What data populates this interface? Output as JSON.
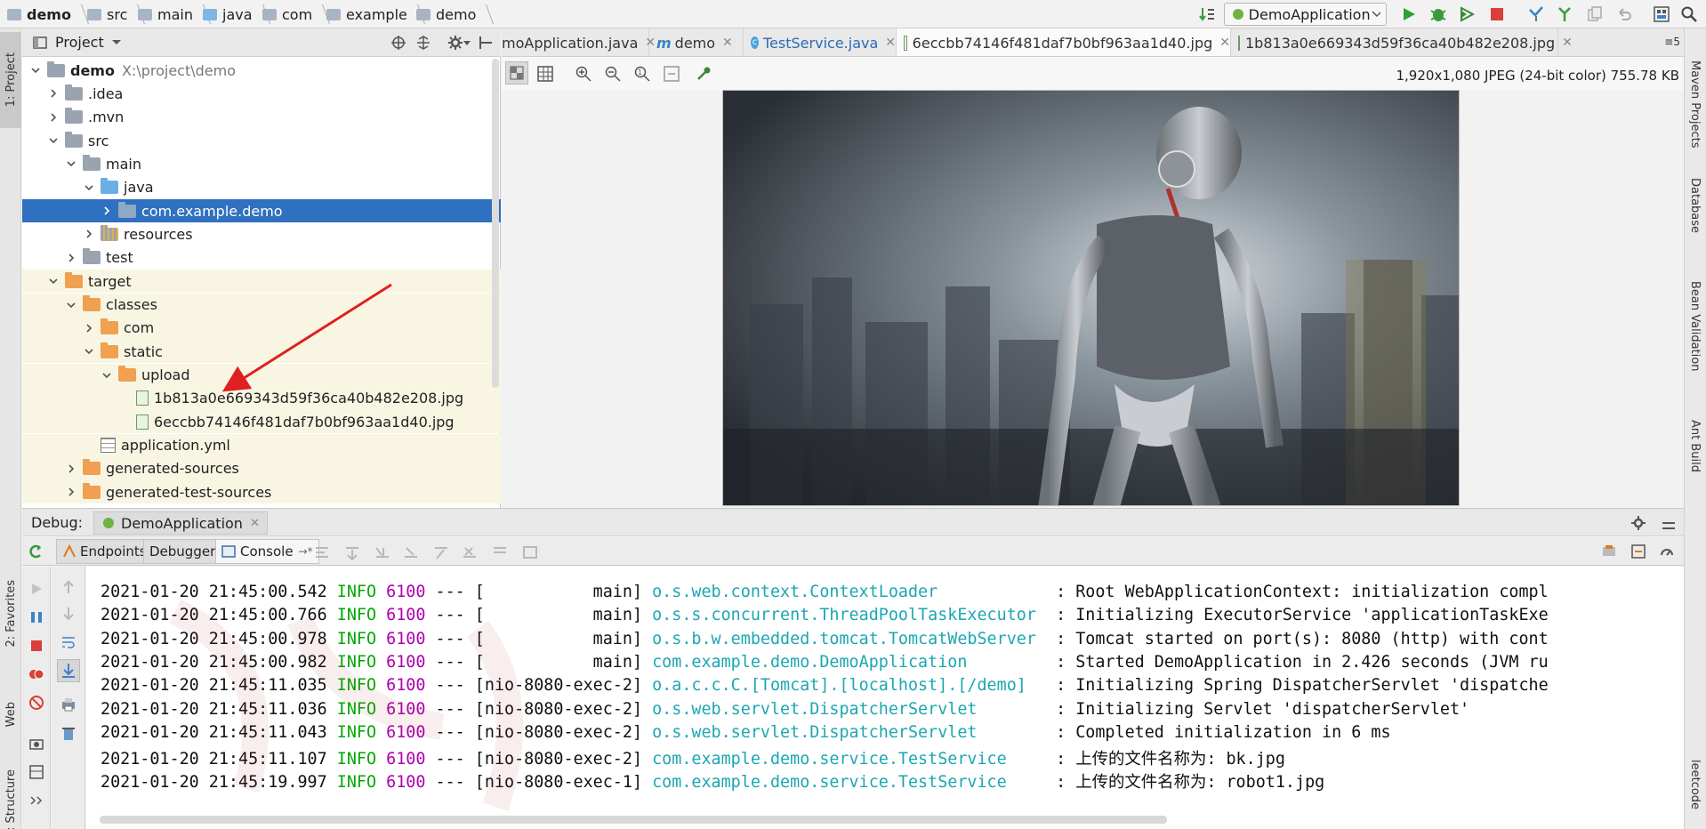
{
  "breadcrumb": [
    {
      "label": "demo",
      "bold": true
    },
    {
      "label": "src"
    },
    {
      "label": "main"
    },
    {
      "label": "java",
      "blue": true
    },
    {
      "label": "com"
    },
    {
      "label": "example"
    },
    {
      "label": "demo"
    }
  ],
  "run_config": {
    "label": "DemoApplication"
  },
  "left_stripe": {
    "project": "1: Project",
    "favorites": "2: Favorites",
    "web": "Web",
    "structure": "Z: Structure"
  },
  "right_stripe": {
    "maven": "Maven Projects",
    "database": "Database",
    "bean": "Bean Validation",
    "ant": "Ant Build",
    "leetcode": "leetcode"
  },
  "project_panel": {
    "title": "Project",
    "tree": [
      {
        "label": "demo",
        "extra": "X:\\project\\demo",
        "level": 0,
        "expanded": true,
        "icon": "module"
      },
      {
        "label": ".idea",
        "level": 1,
        "expanded": false,
        "icon": "folder-grey"
      },
      {
        "label": ".mvn",
        "level": 1,
        "expanded": false,
        "icon": "folder-grey"
      },
      {
        "label": "src",
        "level": 1,
        "expanded": true,
        "icon": "folder-grey"
      },
      {
        "label": "main",
        "level": 2,
        "expanded": true,
        "icon": "folder-grey"
      },
      {
        "label": "java",
        "level": 3,
        "expanded": true,
        "icon": "folder-blue"
      },
      {
        "label": "com.example.demo",
        "level": 4,
        "expanded": false,
        "icon": "package",
        "selected": true
      },
      {
        "label": "resources",
        "level": 3,
        "expanded": false,
        "icon": "folder-res"
      },
      {
        "label": "test",
        "level": 2,
        "expanded": false,
        "icon": "folder-grey"
      },
      {
        "label": "target",
        "level": 1,
        "expanded": true,
        "icon": "folder-orange",
        "target": true
      },
      {
        "label": "classes",
        "level": 2,
        "expanded": true,
        "icon": "folder-orange",
        "target": true
      },
      {
        "label": "com",
        "level": 3,
        "expanded": false,
        "icon": "folder-orange",
        "target": true
      },
      {
        "label": "static",
        "level": 3,
        "expanded": true,
        "icon": "folder-orange",
        "target": true
      },
      {
        "label": "upload",
        "level": 4,
        "expanded": true,
        "icon": "folder-orange",
        "target": true
      },
      {
        "label": "1b813a0e669343d59f36ca40b482e208.jpg",
        "level": 5,
        "icon": "image",
        "target": true
      },
      {
        "label": "6eccbb74146f481daf7b0bf963aa1d40.jpg",
        "level": 5,
        "icon": "image",
        "target": true
      },
      {
        "label": "application.yml",
        "level": 3,
        "icon": "yml",
        "target": true
      },
      {
        "label": "generated-sources",
        "level": 2,
        "expanded": false,
        "icon": "folder-orange",
        "target": true
      },
      {
        "label": "generated-test-sources",
        "level": 2,
        "expanded": false,
        "icon": "folder-orange",
        "target": true
      }
    ]
  },
  "editor_tabs": [
    {
      "label": "moApplication.java",
      "icon": "class"
    },
    {
      "label": "demo",
      "icon": "maven"
    },
    {
      "label": "TestService.java",
      "icon": "class",
      "blue": true
    },
    {
      "label": "6eccbb74146f481daf7b0bf963aa1d40.jpg",
      "icon": "image",
      "active": true
    },
    {
      "label": "1b813a0e669343d59f36ca40b482e208.jpg",
      "icon": "image"
    }
  ],
  "tab_overflow": "5",
  "image_info": "1,920x1,080 JPEG (24-bit color) 755.78 KB",
  "debug": {
    "label": "Debug:",
    "config": "DemoApplication",
    "tabs": {
      "endpoints": "Endpoints",
      "debugger": "Debugger",
      "console": "Console"
    }
  },
  "console_lines": [
    {
      "ts": "2021-01-20 21:45:00.542",
      "level": "INFO",
      "pid": "6100",
      "thread": "[           main]",
      "cls": "o.s.web.context.ContextLoader           ",
      "msg": "Root WebApplicationContext: initialization compl"
    },
    {
      "ts": "2021-01-20 21:45:00.766",
      "level": "INFO",
      "pid": "6100",
      "thread": "[           main]",
      "cls": "o.s.s.concurrent.ThreadPoolTaskExecutor ",
      "msg": "Initializing ExecutorService 'applicationTaskExe"
    },
    {
      "ts": "2021-01-20 21:45:00.978",
      "level": "INFO",
      "pid": "6100",
      "thread": "[           main]",
      "cls": "o.s.b.w.embedded.tomcat.TomcatWebServer ",
      "msg": "Tomcat started on port(s): 8080 (http) with cont"
    },
    {
      "ts": "2021-01-20 21:45:00.982",
      "level": "INFO",
      "pid": "6100",
      "thread": "[           main]",
      "cls": "com.example.demo.DemoApplication        ",
      "msg": "Started DemoApplication in 2.426 seconds (JVM ru"
    },
    {
      "ts": "2021-01-20 21:45:11.035",
      "level": "INFO",
      "pid": "6100",
      "thread": "[nio-8080-exec-2]",
      "cls": "o.a.c.c.C.[Tomcat].[localhost].[/demo]  ",
      "msg": "Initializing Spring DispatcherServlet 'dispatche"
    },
    {
      "ts": "2021-01-20 21:45:11.036",
      "level": "INFO",
      "pid": "6100",
      "thread": "[nio-8080-exec-2]",
      "cls": "o.s.web.servlet.DispatcherServlet       ",
      "msg": "Initializing Servlet 'dispatcherServlet'"
    },
    {
      "ts": "2021-01-20 21:45:11.043",
      "level": "INFO",
      "pid": "6100",
      "thread": "[nio-8080-exec-2]",
      "cls": "o.s.web.servlet.DispatcherServlet       ",
      "msg": "Completed initialization in 6 ms"
    },
    {
      "ts": "2021-01-20 21:45:11.107",
      "level": "INFO",
      "pid": "6100",
      "thread": "[nio-8080-exec-2]",
      "cls": "com.example.demo.service.TestService    ",
      "msg": "上传的文件名称为: bk.jpg"
    },
    {
      "ts": "2021-01-20 21:45:19.997",
      "level": "INFO",
      "pid": "6100",
      "thread": "[nio-8080-exec-1]",
      "cls": "com.example.demo.service.TestService    ",
      "msg": "上传的文件名称为: robot1.jpg"
    }
  ],
  "colors": {
    "selection": "#2f70c0",
    "info": "#00a800",
    "pid": "#b000b0",
    "logger": "#1ba7b2",
    "target_bg": "#f8f6e2"
  }
}
